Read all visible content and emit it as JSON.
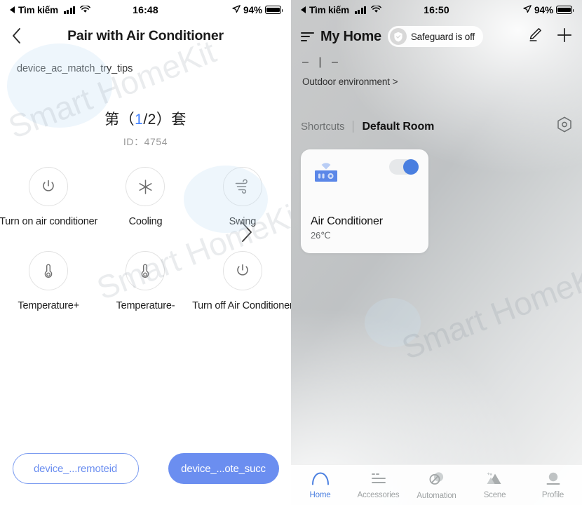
{
  "left": {
    "statusbar": {
      "back_label": "Tìm kiếm",
      "time": "16:48",
      "battery_pct": "94%",
      "signal_icon": "cellular-signal-icon",
      "wifi_icon": "wifi-icon",
      "location_icon": "location-arrow-icon",
      "battery_icon": "battery-full-icon"
    },
    "nav": {
      "back_icon": "chevron-left-icon",
      "title": "Pair with Air Conditioner"
    },
    "tips": "device_ac_match_try_tips",
    "set_prefix": "第（",
    "set_num": "1",
    "set_suffix": "/2）套",
    "id_line": "ID：4754",
    "commands": [
      {
        "label": "Turn on air conditioner",
        "icon": "power-icon"
      },
      {
        "label": "Cooling",
        "icon": "snowflake-icon"
      },
      {
        "label": "Swing",
        "icon": "wind-swing-icon"
      },
      {
        "label": "Temperature+",
        "icon": "thermometer-icon"
      },
      {
        "label": "Temperature-",
        "icon": "thermometer-icon"
      },
      {
        "label": "Turn off Air Conditioner",
        "icon": "power-icon"
      }
    ],
    "next_icon": "chevron-right-icon",
    "buttons": {
      "secondary": "device_...remoteid",
      "primary": "device_...ote_succ"
    },
    "colors": {
      "accent": "#6b8ef0",
      "set_number": "#3d7eff"
    }
  },
  "right": {
    "statusbar": {
      "back_label": "Tìm kiếm",
      "time": "16:50",
      "battery_pct": "94%"
    },
    "nav": {
      "menu_icon": "hamburger-menu-icon",
      "title": "My Home",
      "safeguard": "Safeguard is off",
      "shield_icon": "shield-check-icon",
      "edit_icon": "pencil-edit-icon",
      "add_icon": "plus-icon"
    },
    "environment": {
      "values": "–  |  –",
      "label": "Outdoor environment >"
    },
    "rooms": {
      "shortcuts": "Shortcuts",
      "default_room": "Default Room",
      "gear_icon": "hex-settings-icon"
    },
    "device_card": {
      "name": "Air Conditioner",
      "temperature": "26℃",
      "icon": "air-conditioner-wifi-icon",
      "toggle_on": true
    },
    "tabs": [
      {
        "label": "Home",
        "icon": "home-arch-icon",
        "active": true
      },
      {
        "label": "Accessories",
        "icon": "list-lines-icon",
        "active": false
      },
      {
        "label": "Automation",
        "icon": "circles-overlap-icon",
        "active": false
      },
      {
        "label": "Scene",
        "icon": "mountains-icon",
        "active": false
      },
      {
        "label": "Profile",
        "icon": "person-icon",
        "active": false
      }
    ],
    "colors": {
      "accent": "#4a7fe0",
      "inactive": "#9fa3a4"
    }
  },
  "watermark": "Smart HomeKit"
}
